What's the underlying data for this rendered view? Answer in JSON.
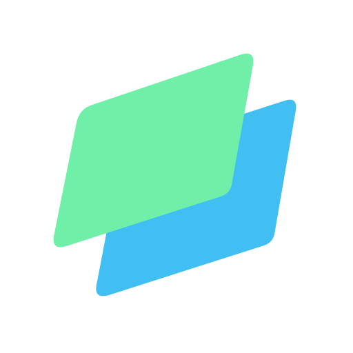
{
  "logo": {
    "icon": "stacked-layers-icon",
    "colors": {
      "background": "#ffffff",
      "front_layer": "#6FEFA7",
      "back_layer": "#42BFF2"
    }
  }
}
